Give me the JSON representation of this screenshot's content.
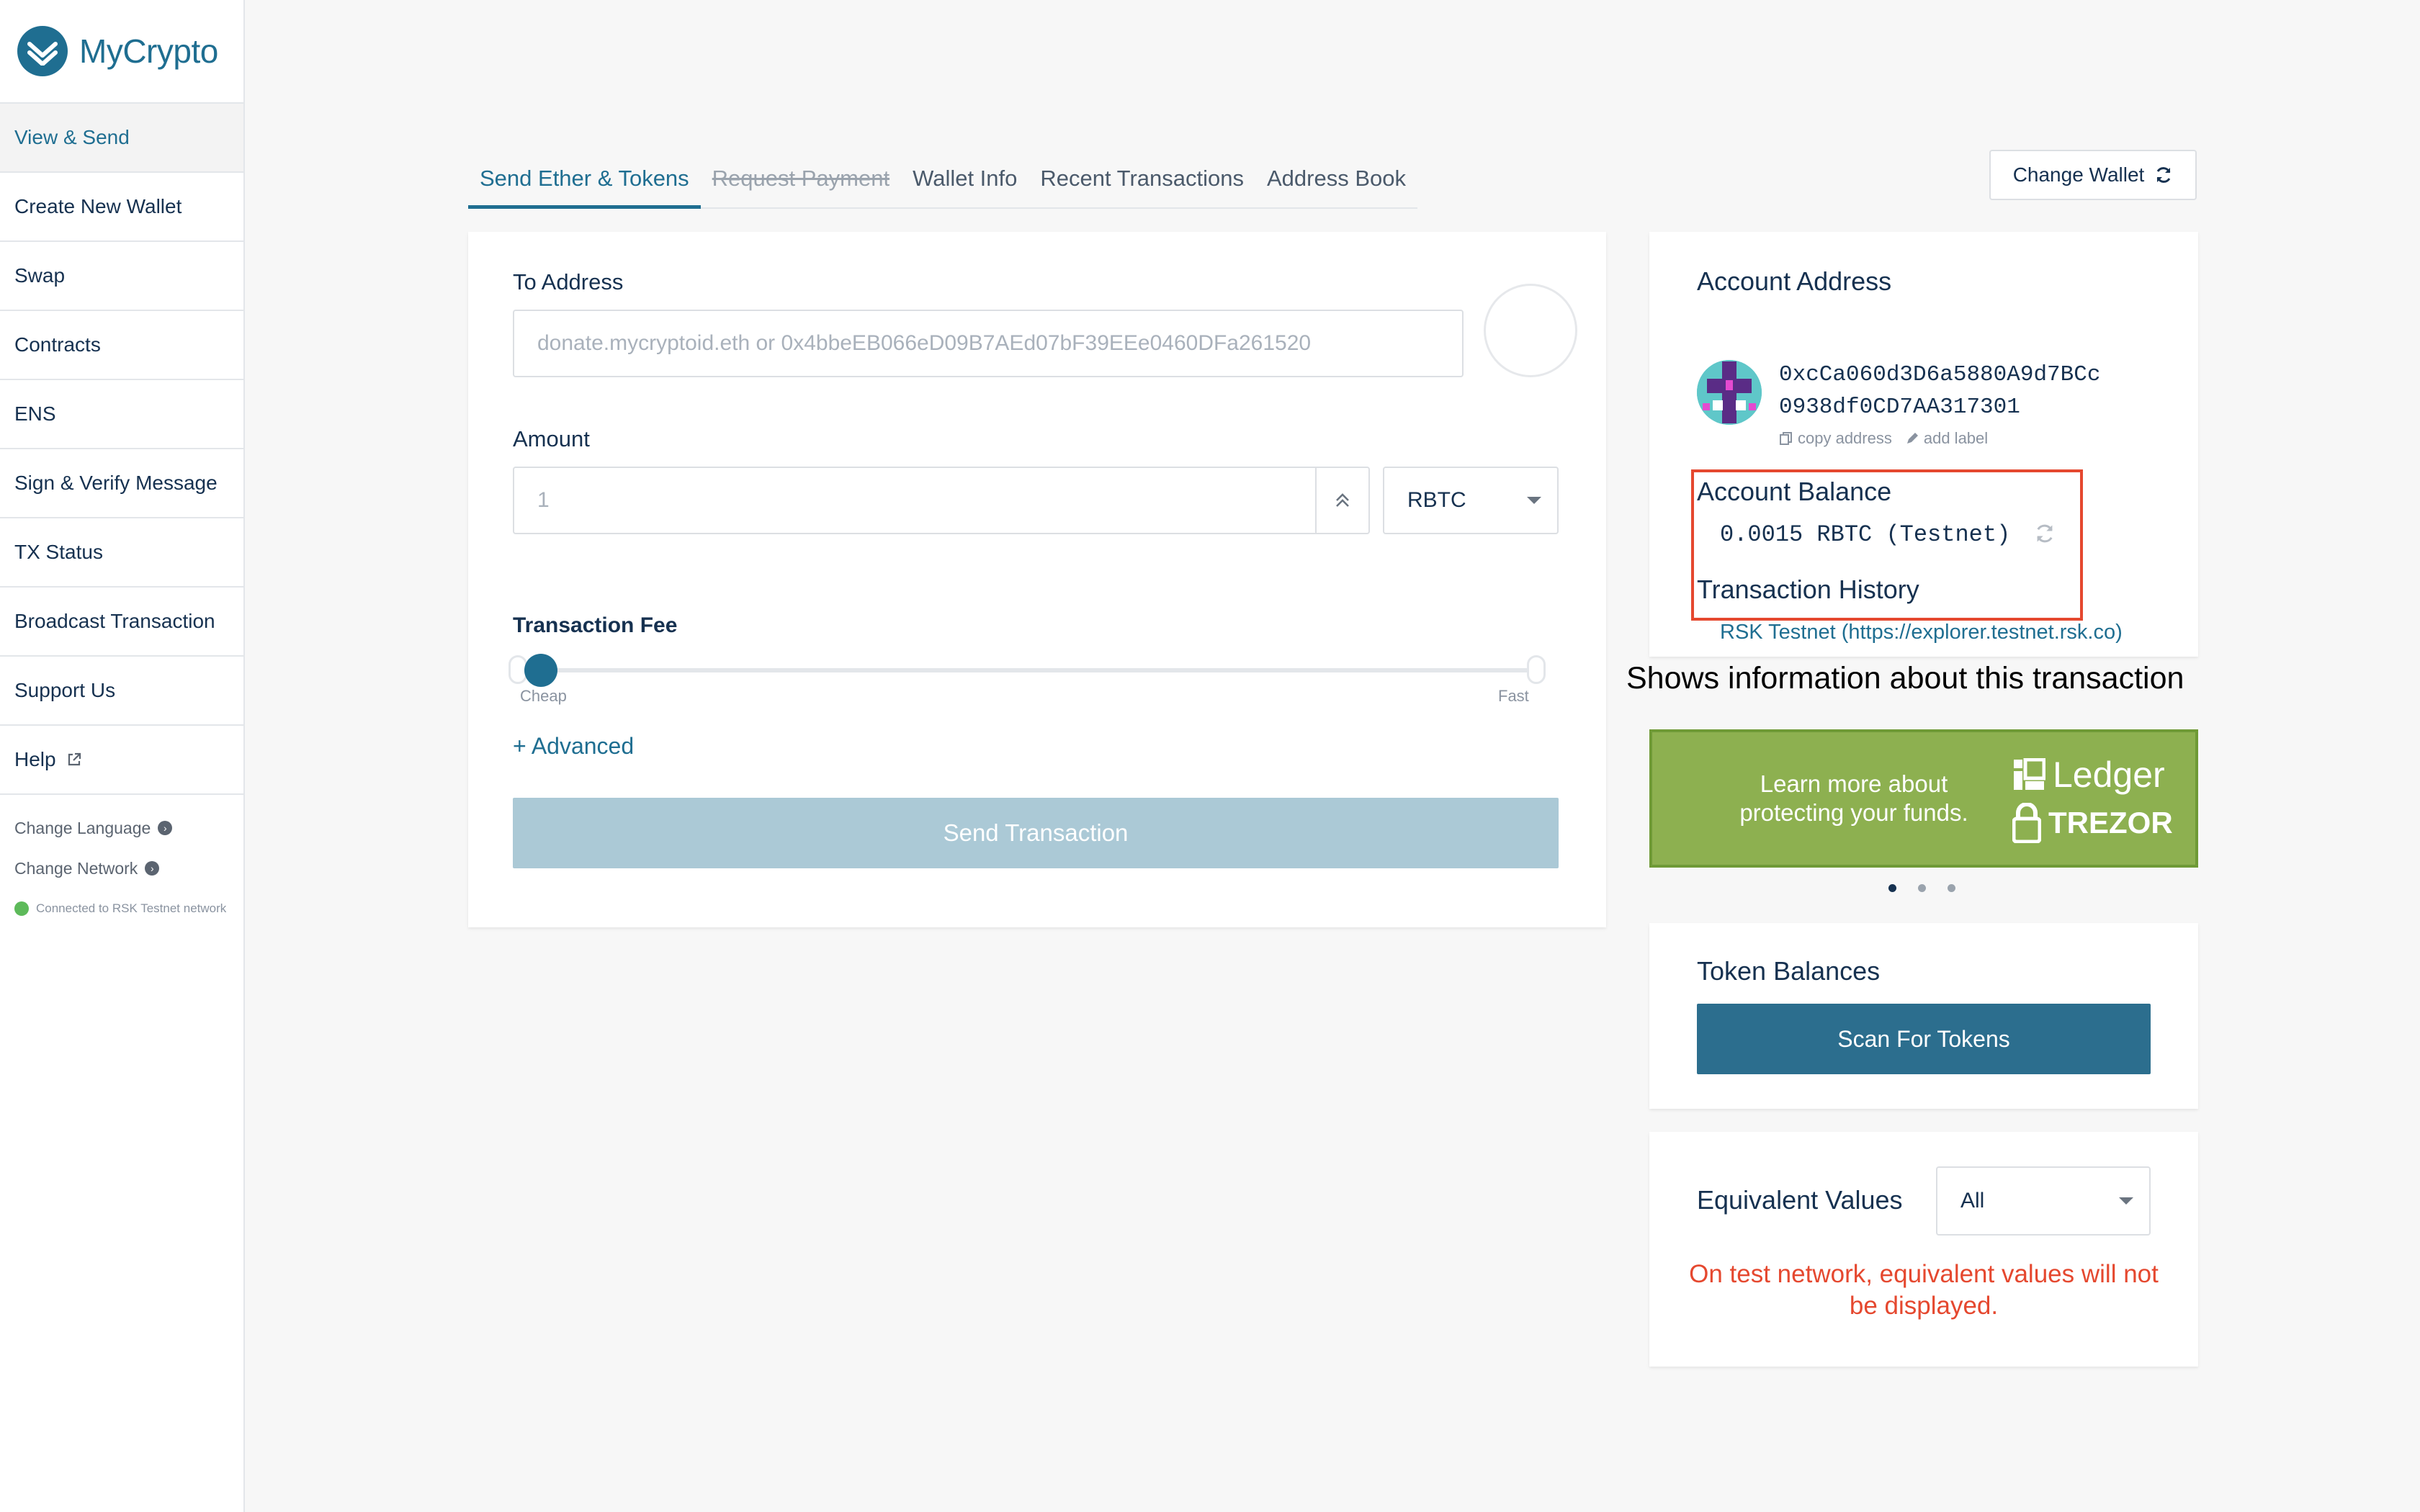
{
  "app": {
    "name": "MyCrypto"
  },
  "sidebar": {
    "items": [
      {
        "label": "View & Send",
        "active": true
      },
      {
        "label": "Create New Wallet"
      },
      {
        "label": "Swap"
      },
      {
        "label": "Contracts"
      },
      {
        "label": "ENS"
      },
      {
        "label": "Sign & Verify Message"
      },
      {
        "label": "TX Status"
      },
      {
        "label": "Broadcast Transaction"
      },
      {
        "label": "Support Us"
      },
      {
        "label": "Help"
      }
    ],
    "change_language": "Change Language",
    "change_network": "Change Network",
    "connection_status": "Connected to RSK Testnet network"
  },
  "tabs": [
    {
      "label": "Send Ether & Tokens",
      "state": "active"
    },
    {
      "label": "Request Payment",
      "state": "disabled"
    },
    {
      "label": "Wallet Info"
    },
    {
      "label": "Recent Transactions"
    },
    {
      "label": "Address Book"
    }
  ],
  "header": {
    "change_wallet_label": "Change Wallet"
  },
  "send_form": {
    "to_address_label": "To Address",
    "to_address_placeholder": "donate.mycryptoid.eth or 0x4bbeEB066eD09B7AEd07bF39EEe0460DFa261520",
    "amount_label": "Amount",
    "amount_placeholder": "1",
    "currency": "RBTC",
    "fee_label": "Transaction Fee",
    "fee_cheap": "Cheap",
    "fee_fast": "Fast",
    "fee_level": 0.0,
    "advanced_label": "+ Advanced",
    "send_label": "Send Transaction"
  },
  "account": {
    "title": "Account Address",
    "address_line1": "0xcCa060d3D6a5880A9d7BCc",
    "address_line2": "0938df0CD7AA317301",
    "copy_label": "copy address",
    "add_label": "add label",
    "balance_title": "Account Balance",
    "balance_value": "0.0015 RBTC (Testnet)",
    "history_title": "Transaction History",
    "history_link": "RSK Testnet (https://explorer.testnet.rsk.co)"
  },
  "annotation": {
    "text": "Shows information about this transaction"
  },
  "ad": {
    "text": "Learn more about protecting your funds.",
    "brand1": "Ledger",
    "brand2": "TREZOR"
  },
  "tokens": {
    "title": "Token Balances",
    "scan_label": "Scan For Tokens"
  },
  "equivalent": {
    "title": "Equivalent Values",
    "selected": "All",
    "note": "On test network, equivalent values will not be displayed."
  },
  "colors": {
    "brand": "#1f6e91",
    "highlight": "#e5482f",
    "ad_green": "#8db050"
  }
}
